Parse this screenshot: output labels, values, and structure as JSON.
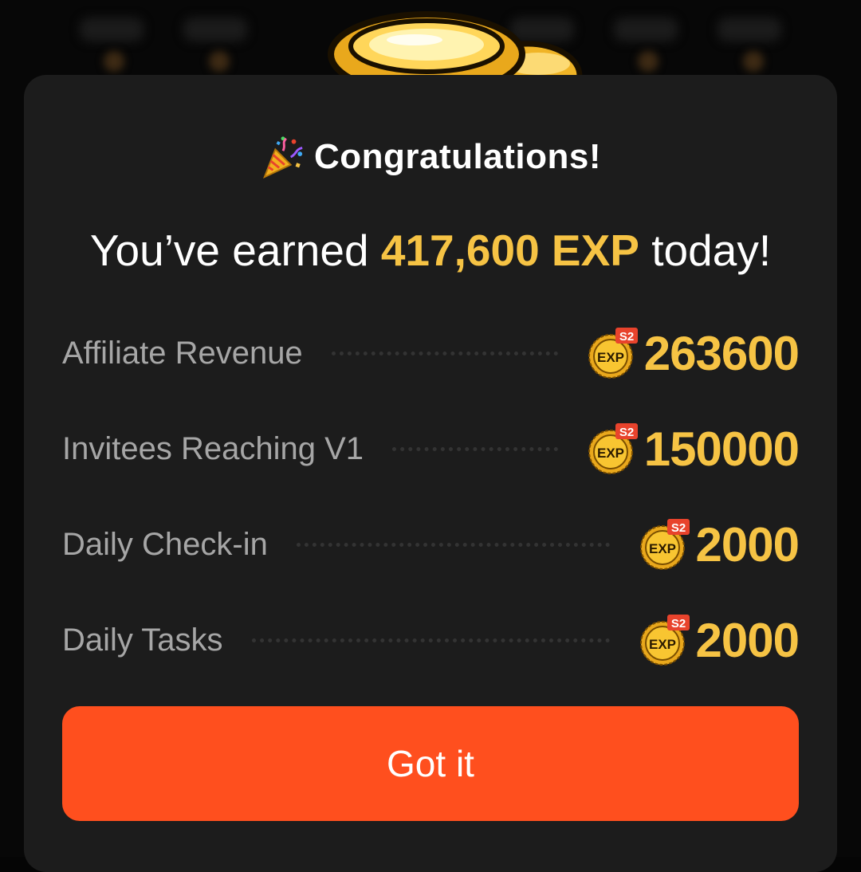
{
  "modal": {
    "title": "Congratulations!",
    "headline": {
      "prefix": "You’ve earned ",
      "amount": "417,600 EXP",
      "suffix": " today!"
    },
    "items": [
      {
        "label": "Affiliate Revenue",
        "badge_season": "S2",
        "badge_text": "EXP",
        "value": "263600"
      },
      {
        "label": "Invitees Reaching V1",
        "badge_season": "S2",
        "badge_text": "EXP",
        "value": "150000"
      },
      {
        "label": "Daily Check-in",
        "badge_season": "S2",
        "badge_text": "EXP",
        "value": "2000"
      },
      {
        "label": "Daily Tasks",
        "badge_season": "S2",
        "badge_text": "EXP",
        "value": "2000"
      }
    ],
    "button_label": "Got it"
  },
  "icons": {
    "title_icon": "party-popper-icon",
    "badge_icon": "exp-coin-icon",
    "header_graphic": "gold-trophy-icon"
  },
  "colors": {
    "accent_gold": "#f6c344",
    "button": "#ff4f1e",
    "modal_bg": "#1c1c1c",
    "label_gray": "#a6a6a6"
  }
}
